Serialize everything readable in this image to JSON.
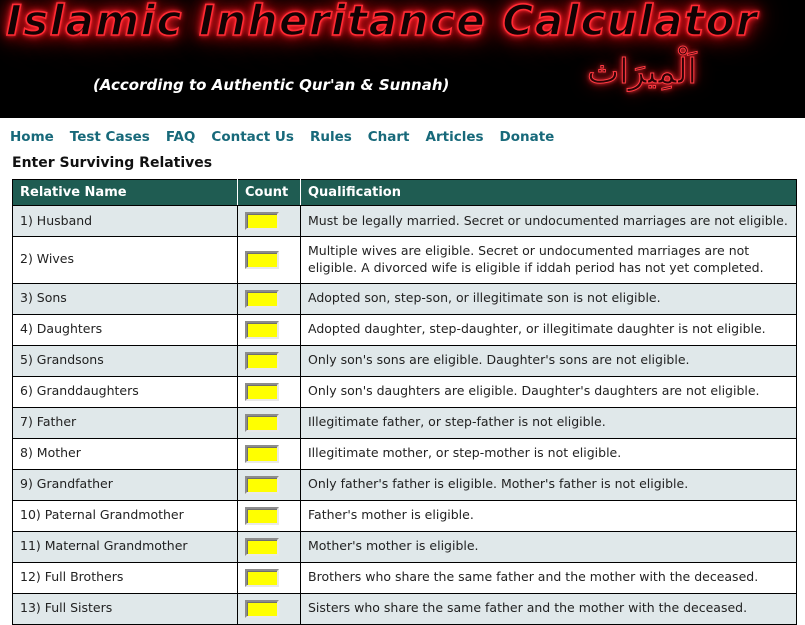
{
  "banner": {
    "title": "Islamic Inheritance Calculator",
    "subtitle": "(According to Authentic Qur'an & Sunnah)",
    "arabic": "اَلْمِيرَاث",
    "background_color": "#000000",
    "title_glow_color": "#ff2a33"
  },
  "nav": {
    "items": [
      {
        "label": "Home"
      },
      {
        "label": "Test Cases"
      },
      {
        "label": "FAQ"
      },
      {
        "label": "Contact Us"
      },
      {
        "label": "Rules"
      },
      {
        "label": "Chart"
      },
      {
        "label": "Articles"
      },
      {
        "label": "Donate"
      }
    ],
    "link_color": "#17697a"
  },
  "page": {
    "heading": "Enter Surviving Relatives"
  },
  "table": {
    "header_bg": "#1f5c52",
    "stripe_color": "#e0e8ea",
    "input_color": "#ffff00",
    "columns": [
      {
        "label": "Relative Name"
      },
      {
        "label": "Count"
      },
      {
        "label": "Qualification"
      }
    ],
    "rows": [
      {
        "name": "1) Husband",
        "count": "",
        "qualification": "Must be legally married. Secret or undocumented marriages are not eligible."
      },
      {
        "name": "2) Wives",
        "count": "",
        "qualification": "Multiple wives are eligible. Secret or undocumented marriages are not eligible. A divorced wife is eligible if iddah period has not yet completed."
      },
      {
        "name": "3) Sons",
        "count": "",
        "qualification": "Adopted son, step-son, or illegitimate son is not eligible."
      },
      {
        "name": "4) Daughters",
        "count": "",
        "qualification": "Adopted daughter, step-daughter, or illegitimate daughter is not eligible."
      },
      {
        "name": "5) Grandsons",
        "count": "",
        "qualification": "Only son's sons are eligible. Daughter's sons are not eligible."
      },
      {
        "name": "6) Granddaughters",
        "count": "",
        "qualification": "Only son's daughters are eligible. Daughter's daughters are not eligible."
      },
      {
        "name": "7) Father",
        "count": "",
        "qualification": "Illegitimate father, or step-father is not eligible."
      },
      {
        "name": "8) Mother",
        "count": "",
        "qualification": "Illegitimate mother, or step-mother is not eligible."
      },
      {
        "name": "9) Grandfather",
        "count": "",
        "qualification": "Only father's father is eligible. Mother's father is not eligible."
      },
      {
        "name": "10) Paternal Grandmother",
        "count": "",
        "qualification": "Father's mother is eligible."
      },
      {
        "name": "11) Maternal Grandmother",
        "count": "",
        "qualification": "Mother's mother is eligible."
      },
      {
        "name": "12) Full Brothers",
        "count": "",
        "qualification": "Brothers who share the same father and the mother with the deceased."
      },
      {
        "name": "13) Full Sisters",
        "count": "",
        "qualification": "Sisters who share the same father and the mother with the deceased."
      }
    ]
  }
}
